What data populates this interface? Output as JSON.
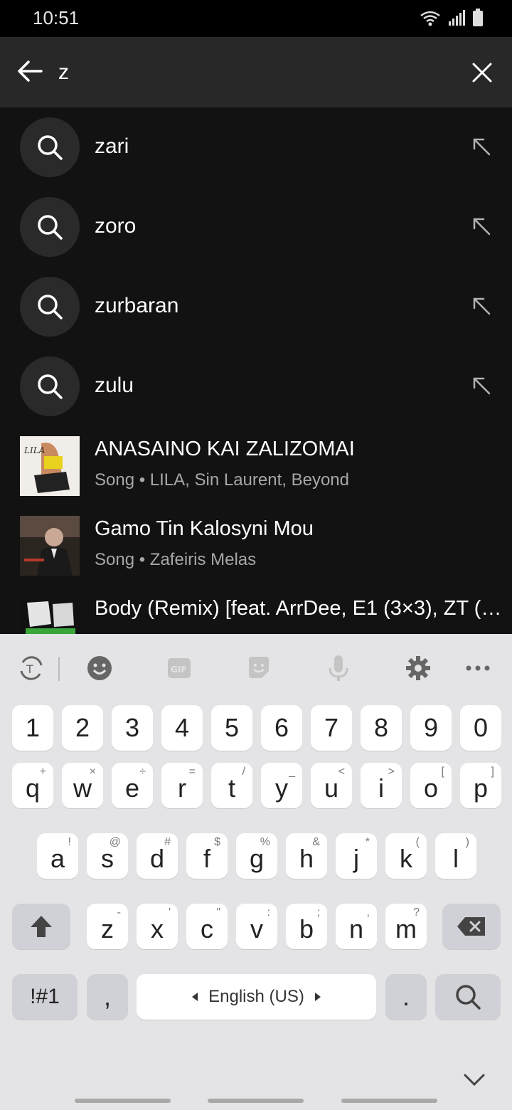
{
  "status_bar": {
    "time": "10:51"
  },
  "search": {
    "value": "z"
  },
  "suggestions": [
    {
      "label": "zari"
    },
    {
      "label": "zoro"
    },
    {
      "label": "zurbaran"
    },
    {
      "label": "zulu"
    }
  ],
  "songs": [
    {
      "title": "ANASAINO KAI ZALIZOMAI",
      "subtitle": "Song • LILA, Sin Laurent, Beyond"
    },
    {
      "title": "Gamo Tin Kalosyni Mou",
      "subtitle": "Song • Zafeiris Melas"
    },
    {
      "title": "Body (Remix) [feat. ArrDee, E1 (3×3), ZT (…",
      "subtitle": ""
    }
  ],
  "keyboard": {
    "number_row": [
      "1",
      "2",
      "3",
      "4",
      "5",
      "6",
      "7",
      "8",
      "9",
      "0"
    ],
    "row1": [
      {
        "key": "q",
        "hint": "+"
      },
      {
        "key": "w",
        "hint": "×"
      },
      {
        "key": "e",
        "hint": "÷"
      },
      {
        "key": "r",
        "hint": "="
      },
      {
        "key": "t",
        "hint": "/"
      },
      {
        "key": "y",
        "hint": "_"
      },
      {
        "key": "u",
        "hint": "<"
      },
      {
        "key": "i",
        "hint": ">"
      },
      {
        "key": "o",
        "hint": "["
      },
      {
        "key": "p",
        "hint": "]"
      }
    ],
    "row2": [
      {
        "key": "a",
        "hint": "!"
      },
      {
        "key": "s",
        "hint": "@"
      },
      {
        "key": "d",
        "hint": "#"
      },
      {
        "key": "f",
        "hint": "$"
      },
      {
        "key": "g",
        "hint": "%"
      },
      {
        "key": "h",
        "hint": "&"
      },
      {
        "key": "j",
        "hint": "*"
      },
      {
        "key": "k",
        "hint": "("
      },
      {
        "key": "l",
        "hint": ")"
      }
    ],
    "row3": [
      {
        "key": "z",
        "hint": "-"
      },
      {
        "key": "x",
        "hint": "'"
      },
      {
        "key": "c",
        "hint": "\""
      },
      {
        "key": "v",
        "hint": ":"
      },
      {
        "key": "b",
        "hint": ";"
      },
      {
        "key": "n",
        "hint": ","
      },
      {
        "key": "m",
        "hint": "?"
      }
    ],
    "symbols_label": "!#1",
    "comma_label": ",",
    "space_label": "English (US)",
    "period_label": "."
  },
  "colors": {
    "background": "#121212",
    "header": "#282828",
    "keyboard": "#e4e4e6"
  }
}
